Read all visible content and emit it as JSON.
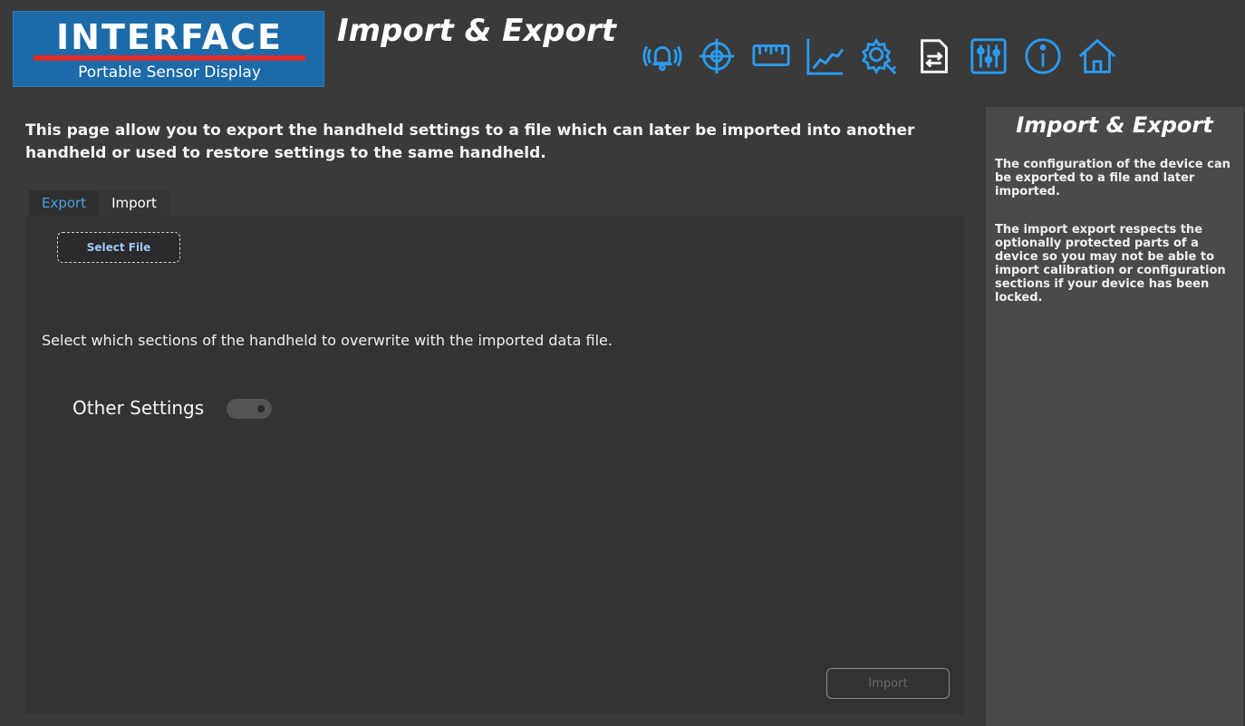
{
  "logo": {
    "word": "INTERFACE",
    "subtitle": "Portable Sensor Display"
  },
  "header": {
    "title": "Import & Export"
  },
  "nav": {
    "icons": [
      "alarm-icon",
      "target-icon",
      "ruler-icon",
      "chart-icon",
      "settings-wrench-icon",
      "import-export-icon",
      "mixer-icon",
      "info-icon",
      "home-icon"
    ],
    "colors": {
      "accent": "#2a9bf0",
      "active": "#ffffff"
    }
  },
  "main": {
    "intro": "This page allow you to export the handheld settings to a file which can later be imported into another handheld or used to restore settings to the same handheld.",
    "tabs": [
      {
        "label": "Export"
      },
      {
        "label": "Import"
      }
    ],
    "select_file": "Select File",
    "instruction": "Select which sections of the handheld to overwrite with the imported data file.",
    "option": {
      "label": "Other Settings"
    },
    "import_button": "Import"
  },
  "side": {
    "title": "Import & Export",
    "p1": "The configuration of the device can be exported to a file and later imported.",
    "p2": "The import export respects the optionally protected parts of a device so you may not be able to import calibration or configuration sections if your device has been locked."
  }
}
